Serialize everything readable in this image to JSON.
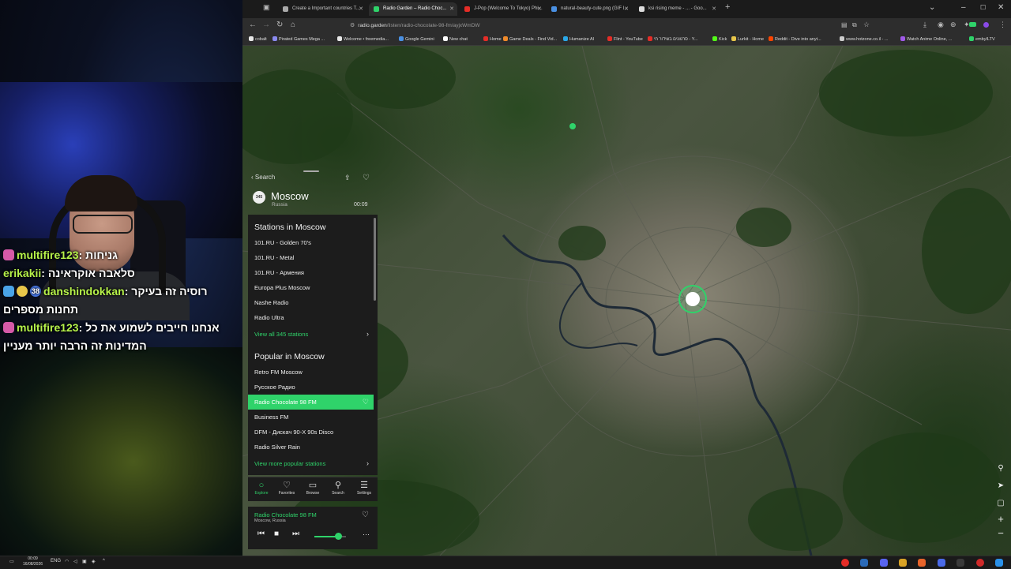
{
  "stream": {
    "chat": [
      {
        "user": "multifire123",
        "message": "גניחות",
        "badge": "pink"
      },
      {
        "user": "erikakii",
        "message": "סלאבה אוקראינה",
        "badge": ""
      },
      {
        "user": "danshindokkan",
        "message": "רוסיה זה בעיקר",
        "badge": "mod",
        "sub": "38"
      },
      {
        "user": "",
        "message": "תחנות מספרים",
        "badge": ""
      },
      {
        "user": "multifire123",
        "message": "אנחנו חייבים לשמוע את כל",
        "badge": "pink"
      },
      {
        "user": "",
        "message": "המדינות זה הרבה יותר מעניין",
        "badge": ""
      }
    ]
  },
  "browser": {
    "tabs": [
      {
        "title": "Create a Important countries T...",
        "active": false,
        "color": "#aaaaaa"
      },
      {
        "title": "Radio Garden – Radio Choc...",
        "active": true,
        "color": "#2fd36a"
      },
      {
        "title": "J-Pop (Welcome To Tokyo) Phi...",
        "active": false,
        "color": "#e52d27"
      },
      {
        "title": "natural-beauty-cute.png (GIF I...",
        "active": false,
        "color": "#4a90e2"
      },
      {
        "title": "ksi rising meme - ... - Goo...",
        "active": false,
        "color": "#dddddd"
      }
    ],
    "url_host": "radio.garden",
    "url_path": "/listen/radio-chocolate-98-fm/ayjxWmDW",
    "bookmarks": [
      "cobalt",
      "Pirated Games Mega ...",
      "Welcome • freemedia...",
      "Google Gemini",
      "New chat",
      "Home",
      "Game Deals - Find Vid...",
      "Humanize AI",
      "Flint - YouTube",
      "סרטונים בשידור חי - Y...",
      "Kick",
      "Lurkit - Home",
      "Reddit - Dive into anyt...",
      "www.hotzone.co.il - ...",
      "Watch Anime Online, ...",
      "embyILTV"
    ]
  },
  "panel": {
    "back_label": "Search",
    "city": "Moscow",
    "country": "Russia",
    "city_badge": "345",
    "elapsed": "00:09",
    "stations_title": "Stations in Moscow",
    "stations": [
      "101.RU - Golden 70's",
      "101.RU - Metal",
      "101.RU - Армения",
      "Europa Plus Moscow",
      "Nashe Radio",
      "Radio Ultra"
    ],
    "view_all": "View all 345 stations",
    "popular_title": "Popular in Moscow",
    "popular": [
      "Retro FM Moscow",
      "Русское Радио",
      "Radio Chocolate 98 FM",
      "Business FM",
      "DFM - Дискач 90-X 90s Disco",
      "Radio Silver Rain"
    ],
    "popular_active_index": 2,
    "view_more": "View more popular stations",
    "nav": [
      "Explore",
      "Favorites",
      "Browse",
      "Search",
      "Settings"
    ],
    "nav_active": "Explore",
    "now_playing": {
      "station": "Radio Chocolate 98 FM",
      "location": "Moscow, Russia",
      "volume": 0.75
    }
  },
  "map": {
    "accent": "#2fd36a"
  },
  "taskbar": {
    "time": "00:09",
    "date": "16/08/2026",
    "lang": "ENG"
  }
}
